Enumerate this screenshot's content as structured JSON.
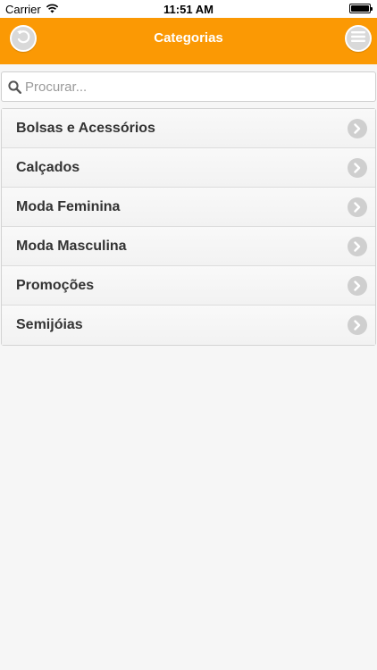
{
  "status_bar": {
    "carrier": "Carrier",
    "time": "11:51 AM"
  },
  "header": {
    "title": "Categorias",
    "back_icon": "back-arrow-icon",
    "menu_icon": "hamburger-menu-icon",
    "accent_color": "#fb9904"
  },
  "search": {
    "placeholder": "Procurar...",
    "value": ""
  },
  "categories": [
    {
      "label": "Bolsas e Acessórios"
    },
    {
      "label": "Calçados"
    },
    {
      "label": "Moda Feminina"
    },
    {
      "label": "Moda Masculina"
    },
    {
      "label": "Promoções"
    },
    {
      "label": "Semijóias"
    }
  ]
}
